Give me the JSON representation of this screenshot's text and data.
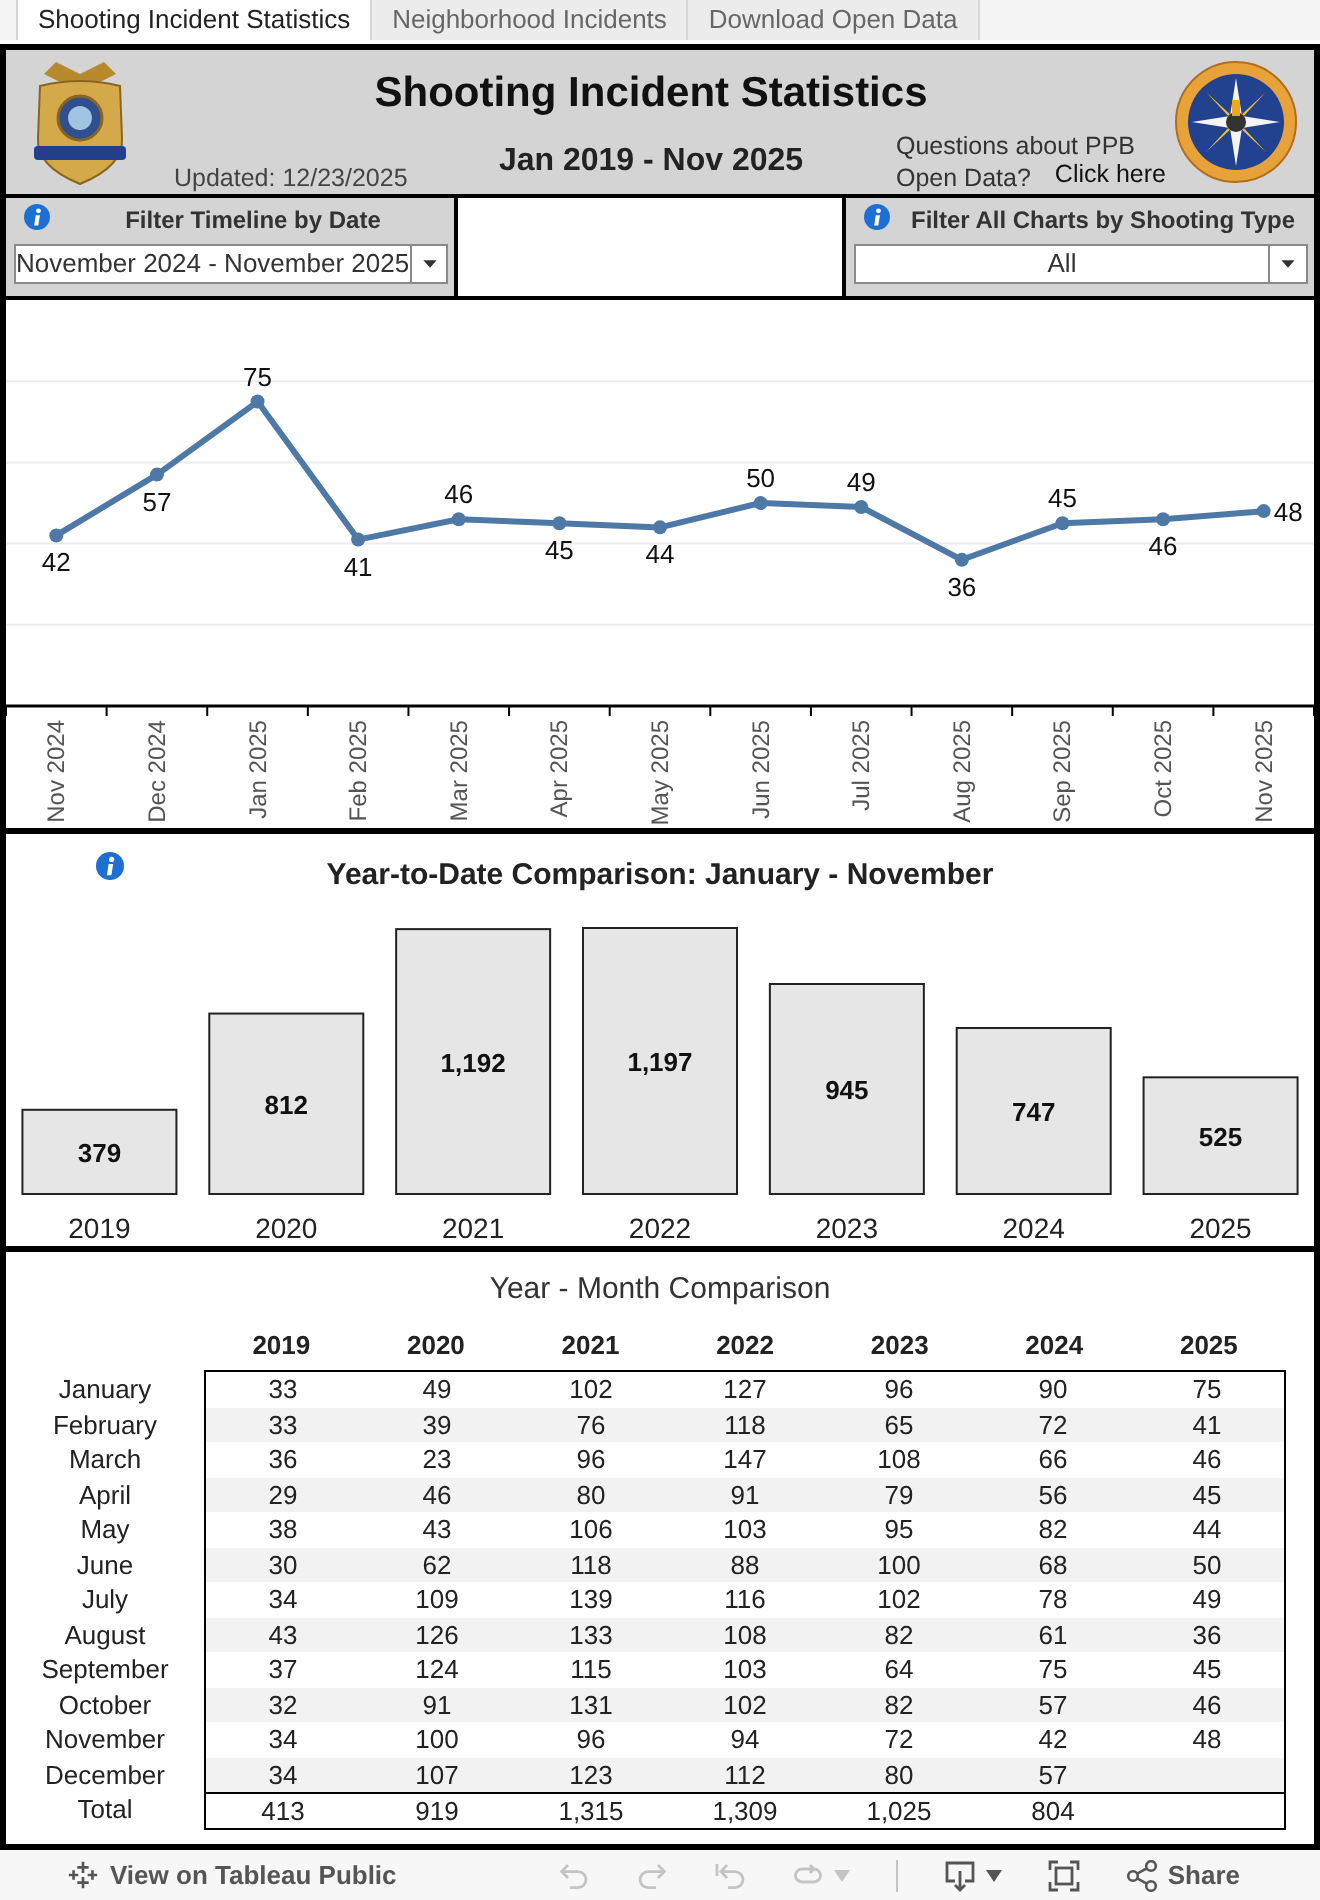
{
  "tabs": [
    {
      "label": "Shooting Incident Statistics",
      "selected": true
    },
    {
      "label": "Neighborhood Incidents",
      "selected": false
    },
    {
      "label": "Download Open Data",
      "selected": false
    }
  ],
  "header": {
    "title": "Shooting Incident Statistics",
    "updated": "Updated: 12/23/2025",
    "date_range": "Jan 2019 - Nov 2025",
    "question_lines": [
      "Questions about PPB",
      "Open Data?"
    ],
    "link": "Click here"
  },
  "filters": [
    {
      "label": "Filter Timeline by Date",
      "value": "November 2024 - November 2025"
    },
    {
      "label": "Filter All Charts by Shooting Type",
      "value": "All"
    }
  ],
  "timeline": {
    "chart_data": {
      "type": "line",
      "categories": [
        "Nov 2024",
        "Dec 2024",
        "Jan 2025",
        "Feb 2025",
        "Mar 2025",
        "Apr 2025",
        "May 2025",
        "Jun 2025",
        "Jul 2025",
        "Aug 2025",
        "Sep 2025",
        "Oct 2025",
        "Nov 2025"
      ],
      "values": [
        42,
        57,
        75,
        41,
        46,
        45,
        44,
        50,
        49,
        36,
        45,
        46,
        48
      ],
      "ylim": [
        0,
        100
      ],
      "marker": true,
      "data_labels": true
    }
  },
  "ytd": {
    "chart_data": {
      "type": "bar",
      "title": "Year-to-Date Comparison: January - November",
      "categories": [
        "2019",
        "2020",
        "2021",
        "2022",
        "2023",
        "2024",
        "2025"
      ],
      "values": [
        379,
        812,
        1192,
        1197,
        945,
        747,
        525
      ],
      "value_labels": [
        "379",
        "812",
        "1,192",
        "1,197",
        "945",
        "747",
        "525"
      ]
    }
  },
  "month_table": {
    "title": "Year - Month Comparison",
    "columns": [
      "2019",
      "2020",
      "2021",
      "2022",
      "2023",
      "2024",
      "2025"
    ],
    "rows": [
      {
        "label": "January",
        "cells": [
          "33",
          "49",
          "102",
          "127",
          "96",
          "90",
          "75"
        ]
      },
      {
        "label": "February",
        "cells": [
          "33",
          "39",
          "76",
          "118",
          "65",
          "72",
          "41"
        ]
      },
      {
        "label": "March",
        "cells": [
          "36",
          "23",
          "96",
          "147",
          "108",
          "66",
          "46"
        ]
      },
      {
        "label": "April",
        "cells": [
          "29",
          "46",
          "80",
          "91",
          "79",
          "56",
          "45"
        ]
      },
      {
        "label": "May",
        "cells": [
          "38",
          "43",
          "106",
          "103",
          "95",
          "82",
          "44"
        ]
      },
      {
        "label": "June",
        "cells": [
          "30",
          "62",
          "118",
          "88",
          "100",
          "68",
          "50"
        ]
      },
      {
        "label": "July",
        "cells": [
          "34",
          "109",
          "139",
          "116",
          "102",
          "78",
          "49"
        ]
      },
      {
        "label": "August",
        "cells": [
          "43",
          "126",
          "133",
          "108",
          "82",
          "61",
          "36"
        ]
      },
      {
        "label": "September",
        "cells": [
          "37",
          "124",
          "115",
          "103",
          "64",
          "75",
          "45"
        ]
      },
      {
        "label": "October",
        "cells": [
          "32",
          "91",
          "131",
          "102",
          "82",
          "57",
          "46"
        ]
      },
      {
        "label": "November",
        "cells": [
          "34",
          "100",
          "96",
          "94",
          "72",
          "42",
          "48"
        ]
      },
      {
        "label": "December",
        "cells": [
          "34",
          "107",
          "123",
          "112",
          "80",
          "57"
        ]
      }
    ],
    "total": {
      "label": "Total",
      "cells": [
        "413",
        "919",
        "1,315",
        "1,309",
        "1,025",
        "804"
      ]
    }
  },
  "toolbar": {
    "view_link": "View on Tableau Public",
    "buttons": [
      {
        "kind": "undo",
        "disabled": true
      },
      {
        "kind": "redo",
        "disabled": true
      },
      {
        "kind": "revert",
        "disabled": true
      },
      {
        "kind": "refresh",
        "disabled": true
      },
      {
        "kind": "download",
        "disabled": false
      },
      {
        "kind": "fullscreen",
        "disabled": false
      },
      {
        "kind": "share",
        "label": "Share",
        "disabled": false
      }
    ]
  }
}
